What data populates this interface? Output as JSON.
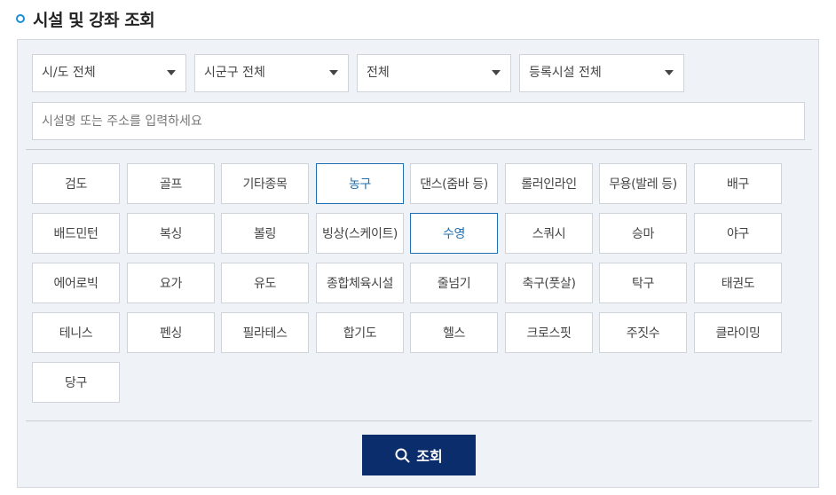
{
  "header": {
    "title": "시설 및 강좌 조회"
  },
  "filters": {
    "region": "시/도 전체",
    "district": "시군구 전체",
    "category": "전체",
    "facility": "등록시설 전체"
  },
  "search": {
    "placeholder": "시설명 또는 주소를 입력하세요",
    "value": ""
  },
  "sports": [
    {
      "label": "검도",
      "active": false
    },
    {
      "label": "골프",
      "active": false
    },
    {
      "label": "기타종목",
      "active": false
    },
    {
      "label": "농구",
      "active": true
    },
    {
      "label": "댄스(줌바 등)",
      "active": false
    },
    {
      "label": "롤러인라인",
      "active": false
    },
    {
      "label": "무용(발레 등)",
      "active": false
    },
    {
      "label": "배구",
      "active": false
    },
    {
      "label": "배드민턴",
      "active": false
    },
    {
      "label": "복싱",
      "active": false
    },
    {
      "label": "볼링",
      "active": false
    },
    {
      "label": "빙상(스케이트)",
      "active": false
    },
    {
      "label": "수영",
      "active": true
    },
    {
      "label": "스쿼시",
      "active": false
    },
    {
      "label": "승마",
      "active": false
    },
    {
      "label": "야구",
      "active": false
    },
    {
      "label": "에어로빅",
      "active": false
    },
    {
      "label": "요가",
      "active": false
    },
    {
      "label": "유도",
      "active": false
    },
    {
      "label": "종합체육시설",
      "active": false
    },
    {
      "label": "줄넘기",
      "active": false
    },
    {
      "label": "축구(풋살)",
      "active": false
    },
    {
      "label": "탁구",
      "active": false
    },
    {
      "label": "태권도",
      "active": false
    },
    {
      "label": "테니스",
      "active": false
    },
    {
      "label": "펜싱",
      "active": false
    },
    {
      "label": "필라테스",
      "active": false
    },
    {
      "label": "합기도",
      "active": false
    },
    {
      "label": "헬스",
      "active": false
    },
    {
      "label": "크로스핏",
      "active": false
    },
    {
      "label": "주짓수",
      "active": false
    },
    {
      "label": "클라이밍",
      "active": false
    },
    {
      "label": "당구",
      "active": false
    }
  ],
  "submit": {
    "label": "조회",
    "icon": "search-icon"
  },
  "colors": {
    "accent": "#1a8fd4",
    "active": "#1f6fb2",
    "submit_bg": "#0c2d6b",
    "panel_bg": "#eff2f6"
  }
}
